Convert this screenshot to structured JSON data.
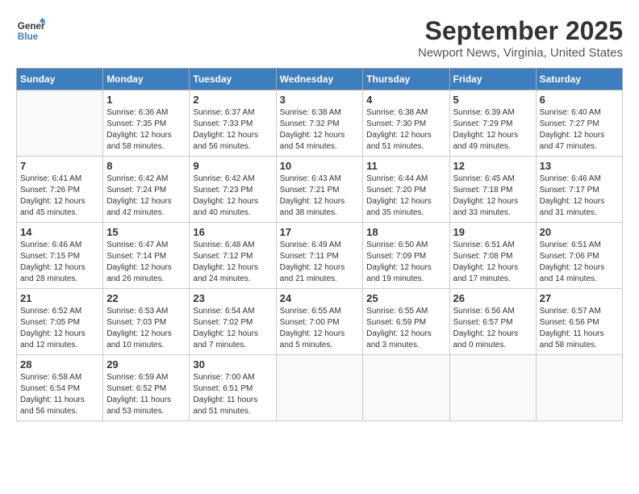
{
  "header": {
    "logo_line1": "General",
    "logo_line2": "Blue",
    "month": "September 2025",
    "location": "Newport News, Virginia, United States"
  },
  "weekdays": [
    "Sunday",
    "Monday",
    "Tuesday",
    "Wednesday",
    "Thursday",
    "Friday",
    "Saturday"
  ],
  "weeks": [
    [
      {
        "day": "",
        "info": ""
      },
      {
        "day": "1",
        "info": "Sunrise: 6:36 AM\nSunset: 7:35 PM\nDaylight: 12 hours\nand 58 minutes."
      },
      {
        "day": "2",
        "info": "Sunrise: 6:37 AM\nSunset: 7:33 PM\nDaylight: 12 hours\nand 56 minutes."
      },
      {
        "day": "3",
        "info": "Sunrise: 6:38 AM\nSunset: 7:32 PM\nDaylight: 12 hours\nand 54 minutes."
      },
      {
        "day": "4",
        "info": "Sunrise: 6:38 AM\nSunset: 7:30 PM\nDaylight: 12 hours\nand 51 minutes."
      },
      {
        "day": "5",
        "info": "Sunrise: 6:39 AM\nSunset: 7:29 PM\nDaylight: 12 hours\nand 49 minutes."
      },
      {
        "day": "6",
        "info": "Sunrise: 6:40 AM\nSunset: 7:27 PM\nDaylight: 12 hours\nand 47 minutes."
      }
    ],
    [
      {
        "day": "7",
        "info": "Sunrise: 6:41 AM\nSunset: 7:26 PM\nDaylight: 12 hours\nand 45 minutes."
      },
      {
        "day": "8",
        "info": "Sunrise: 6:42 AM\nSunset: 7:24 PM\nDaylight: 12 hours\nand 42 minutes."
      },
      {
        "day": "9",
        "info": "Sunrise: 6:42 AM\nSunset: 7:23 PM\nDaylight: 12 hours\nand 40 minutes."
      },
      {
        "day": "10",
        "info": "Sunrise: 6:43 AM\nSunset: 7:21 PM\nDaylight: 12 hours\nand 38 minutes."
      },
      {
        "day": "11",
        "info": "Sunrise: 6:44 AM\nSunset: 7:20 PM\nDaylight: 12 hours\nand 35 minutes."
      },
      {
        "day": "12",
        "info": "Sunrise: 6:45 AM\nSunset: 7:18 PM\nDaylight: 12 hours\nand 33 minutes."
      },
      {
        "day": "13",
        "info": "Sunrise: 6:46 AM\nSunset: 7:17 PM\nDaylight: 12 hours\nand 31 minutes."
      }
    ],
    [
      {
        "day": "14",
        "info": "Sunrise: 6:46 AM\nSunset: 7:15 PM\nDaylight: 12 hours\nand 28 minutes."
      },
      {
        "day": "15",
        "info": "Sunrise: 6:47 AM\nSunset: 7:14 PM\nDaylight: 12 hours\nand 26 minutes."
      },
      {
        "day": "16",
        "info": "Sunrise: 6:48 AM\nSunset: 7:12 PM\nDaylight: 12 hours\nand 24 minutes."
      },
      {
        "day": "17",
        "info": "Sunrise: 6:49 AM\nSunset: 7:11 PM\nDaylight: 12 hours\nand 21 minutes."
      },
      {
        "day": "18",
        "info": "Sunrise: 6:50 AM\nSunset: 7:09 PM\nDaylight: 12 hours\nand 19 minutes."
      },
      {
        "day": "19",
        "info": "Sunrise: 6:51 AM\nSunset: 7:08 PM\nDaylight: 12 hours\nand 17 minutes."
      },
      {
        "day": "20",
        "info": "Sunrise: 6:51 AM\nSunset: 7:06 PM\nDaylight: 12 hours\nand 14 minutes."
      }
    ],
    [
      {
        "day": "21",
        "info": "Sunrise: 6:52 AM\nSunset: 7:05 PM\nDaylight: 12 hours\nand 12 minutes."
      },
      {
        "day": "22",
        "info": "Sunrise: 6:53 AM\nSunset: 7:03 PM\nDaylight: 12 hours\nand 10 minutes."
      },
      {
        "day": "23",
        "info": "Sunrise: 6:54 AM\nSunset: 7:02 PM\nDaylight: 12 hours\nand 7 minutes."
      },
      {
        "day": "24",
        "info": "Sunrise: 6:55 AM\nSunset: 7:00 PM\nDaylight: 12 hours\nand 5 minutes."
      },
      {
        "day": "25",
        "info": "Sunrise: 6:55 AM\nSunset: 6:59 PM\nDaylight: 12 hours\nand 3 minutes."
      },
      {
        "day": "26",
        "info": "Sunrise: 6:56 AM\nSunset: 6:57 PM\nDaylight: 12 hours\nand 0 minutes."
      },
      {
        "day": "27",
        "info": "Sunrise: 6:57 AM\nSunset: 6:56 PM\nDaylight: 11 hours\nand 58 minutes."
      }
    ],
    [
      {
        "day": "28",
        "info": "Sunrise: 6:58 AM\nSunset: 6:54 PM\nDaylight: 11 hours\nand 56 minutes."
      },
      {
        "day": "29",
        "info": "Sunrise: 6:59 AM\nSunset: 6:52 PM\nDaylight: 11 hours\nand 53 minutes."
      },
      {
        "day": "30",
        "info": "Sunrise: 7:00 AM\nSunset: 6:51 PM\nDaylight: 11 hours\nand 51 minutes."
      },
      {
        "day": "",
        "info": ""
      },
      {
        "day": "",
        "info": ""
      },
      {
        "day": "",
        "info": ""
      },
      {
        "day": "",
        "info": ""
      }
    ]
  ]
}
